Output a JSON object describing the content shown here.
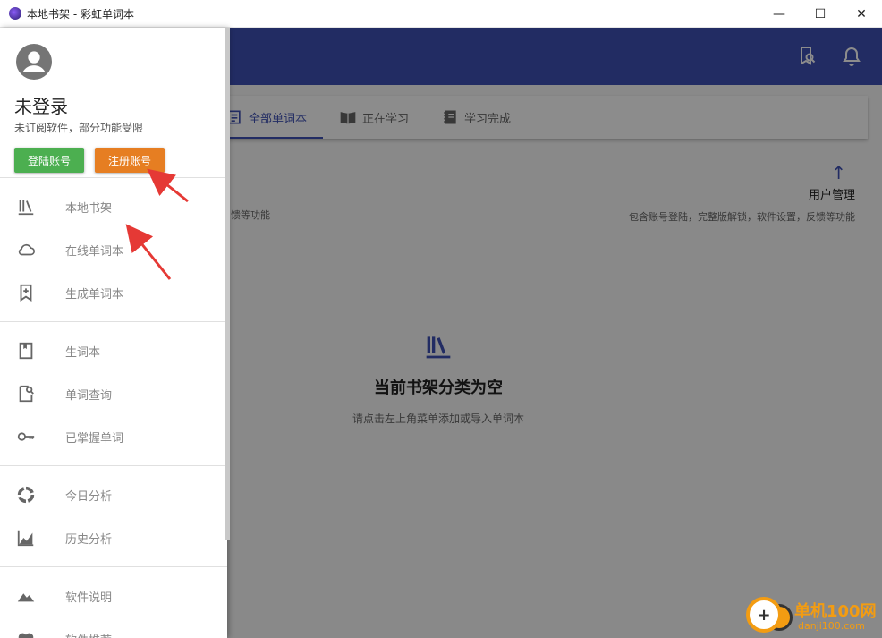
{
  "window": {
    "title": "本地书架 - 彩虹单词本",
    "minimize": "—",
    "maximize": "☐",
    "close": "✕"
  },
  "tabs": [
    {
      "label": "全部单词本",
      "icon": "list-icon",
      "active": true
    },
    {
      "label": "正在学习",
      "icon": "open-book-icon",
      "active": false
    },
    {
      "label": "学习完成",
      "icon": "notebook-icon",
      "active": false
    }
  ],
  "hint": {
    "arrow": "↑",
    "title": "用户管理",
    "desc": "包含账号登陆，完整版解锁，软件设置，反馈等功能",
    "left_desc": "馈等功能"
  },
  "empty": {
    "title": "当前书架分类为空",
    "desc": "请点击左上角菜单添加或导入单词本"
  },
  "drawer": {
    "user_name": "未登录",
    "user_sub": "未订阅软件，部分功能受限",
    "login_label": "登陆账号",
    "register_label": "注册账号",
    "groups": [
      [
        {
          "label": "本地书架",
          "icon": "library-icon"
        },
        {
          "label": "在线单词本",
          "icon": "cloud-icon"
        },
        {
          "label": "生成单词本",
          "icon": "bookmark-add-icon"
        }
      ],
      [
        {
          "label": "生词本",
          "icon": "book-icon"
        },
        {
          "label": "单词查询",
          "icon": "search-doc-icon"
        },
        {
          "label": "已掌握单词",
          "icon": "key-icon"
        }
      ],
      [
        {
          "label": "今日分析",
          "icon": "pie-icon"
        },
        {
          "label": "历史分析",
          "icon": "area-chart-icon"
        }
      ],
      [
        {
          "label": "软件说明",
          "icon": "mountain-icon"
        },
        {
          "label": "软件推荐",
          "icon": "heart-icon"
        }
      ]
    ]
  },
  "colors": {
    "primary": "#3f51b5",
    "login": "#4caf50",
    "register": "#e67e22",
    "annotation": "#e53935"
  },
  "watermark": {
    "text": "单机100网",
    "url": "danji100.com"
  }
}
